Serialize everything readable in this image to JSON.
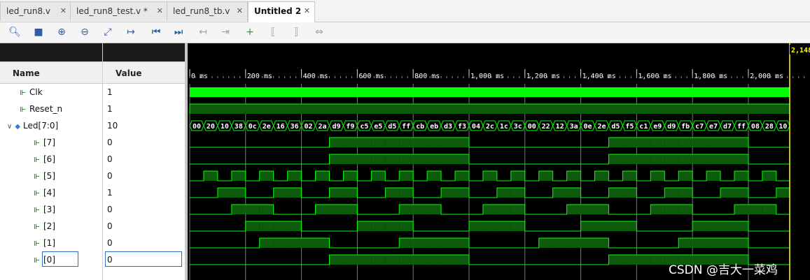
{
  "tabs": [
    {
      "label": "led_run8.v",
      "active": false
    },
    {
      "label": "led_run8_test.v *",
      "active": false
    },
    {
      "label": "led_run8_tb.v",
      "active": false
    },
    {
      "label": "Untitled 2",
      "active": true
    }
  ],
  "toolbar": {
    "icons": [
      "search-icon",
      "save-icon",
      "zoom-in-icon",
      "zoom-out-icon",
      "zoom-fit-icon",
      "go-to-cursor-icon",
      "go-to-time-0-icon",
      "go-to-last-time-icon",
      "previous-transition-icon",
      "next-transition-icon",
      "add-marker-icon",
      "previous-marker-icon",
      "next-marker-icon",
      "swap-cursors-icon"
    ]
  },
  "columns": {
    "name": "Name",
    "value": "Value"
  },
  "signals": [
    {
      "name": "Clk",
      "value": "1",
      "type": "bit"
    },
    {
      "name": "Reset_n",
      "value": "1",
      "type": "bit"
    },
    {
      "name": "Led[7:0]",
      "value": "10",
      "type": "bus",
      "expanded": true
    },
    {
      "name": "[7]",
      "value": "0",
      "type": "bit"
    },
    {
      "name": "[6]",
      "value": "0",
      "type": "bit"
    },
    {
      "name": "[5]",
      "value": "0",
      "type": "bit"
    },
    {
      "name": "[4]",
      "value": "1",
      "type": "bit"
    },
    {
      "name": "[3]",
      "value": "0",
      "type": "bit"
    },
    {
      "name": "[2]",
      "value": "0",
      "type": "bit"
    },
    {
      "name": "[1]",
      "value": "0",
      "type": "bit"
    },
    {
      "name": "[0]",
      "value": "0",
      "type": "bit"
    }
  ],
  "timeline": {
    "labels": [
      "0 ms",
      "200 ms",
      "400 ms",
      "600 ms",
      "800 ms",
      "1,000 ms",
      "1,200 ms",
      "1,400 ms",
      "1,600 ms",
      "1,800 ms",
      "2,000 ms"
    ],
    "cursor_label": "2,148",
    "cursor_ms": 2148,
    "max_ms": 2210
  },
  "bus_values": [
    "00",
    "20",
    "10",
    "38",
    "0c",
    "2e",
    "16",
    "36",
    "02",
    "2a",
    "d9",
    "f9",
    "c5",
    "e5",
    "d5",
    "ff",
    "cb",
    "eb",
    "d3",
    "f3",
    "04",
    "2c",
    "1c",
    "3c",
    "00",
    "22",
    "12",
    "3a",
    "0e",
    "2e",
    "d5",
    "f5",
    "c1",
    "e9",
    "d9",
    "fb",
    "c7",
    "e7",
    "d7",
    "ff",
    "08",
    "28",
    "10"
  ],
  "colors": {
    "wave": "#00ff00",
    "wave_fill": "#0d5c0d",
    "grid": "#7a7a7a",
    "cursor": "#ffff00",
    "bus_line": "#00ff00"
  },
  "watermark": "CSDN @吉大一菜鸡"
}
